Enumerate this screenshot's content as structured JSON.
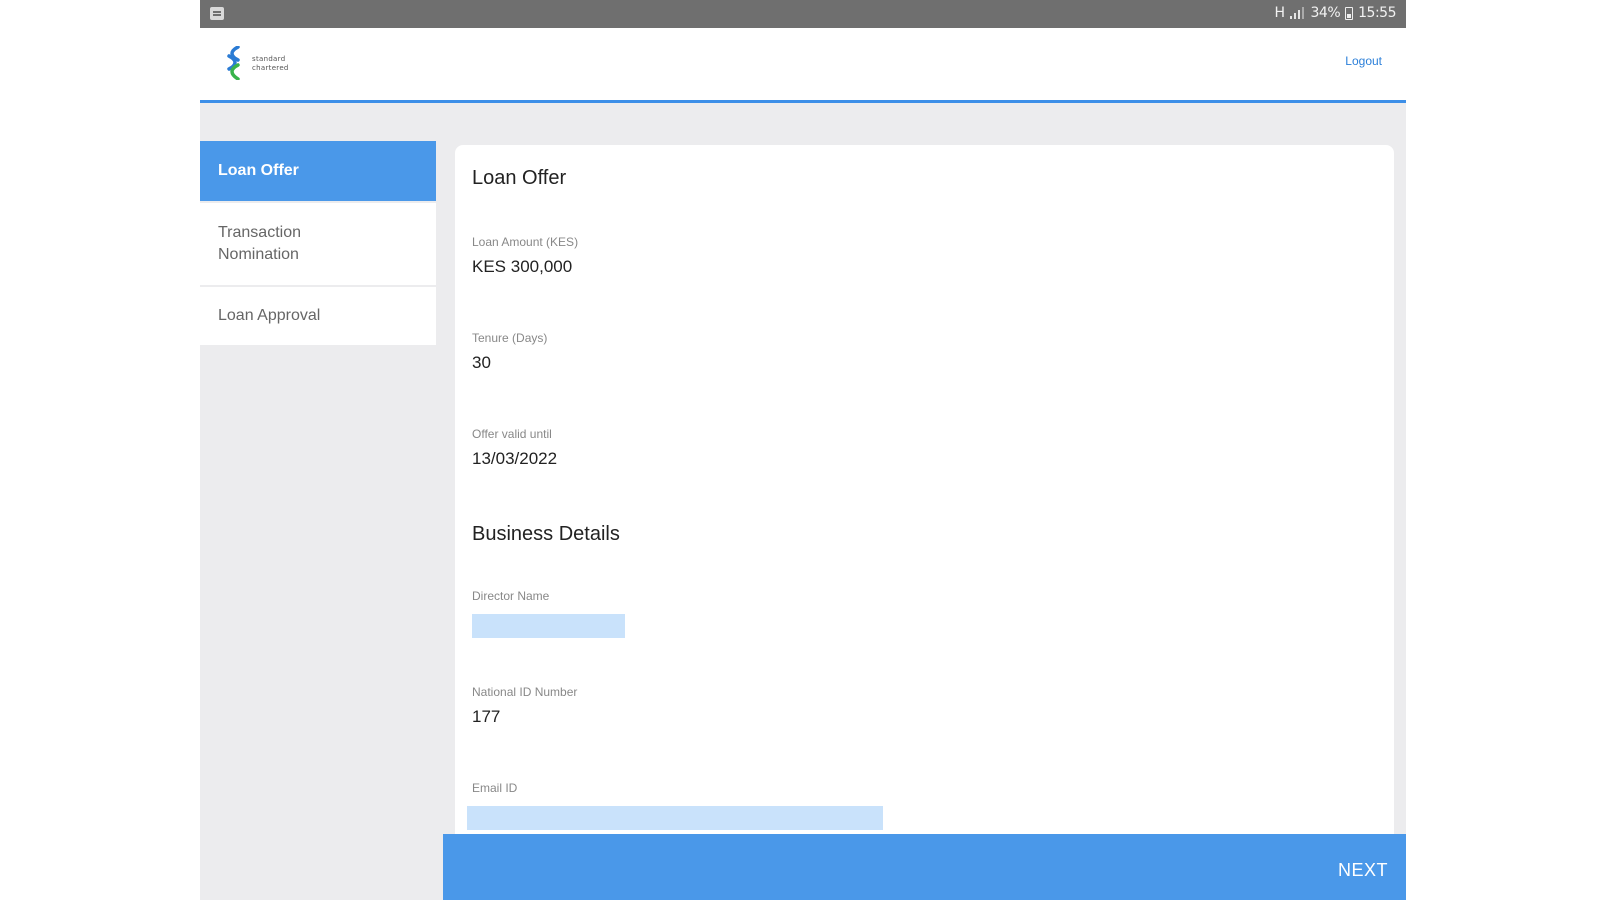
{
  "status_bar": {
    "network": "H",
    "battery": "34%",
    "time": "15:55"
  },
  "header": {
    "logo_alt": "Standard Chartered",
    "logo_line1": "standard",
    "logo_line2": "chartered",
    "logout_label": "Logout"
  },
  "sidebar": {
    "items": [
      {
        "label": "Loan Offer",
        "active": true
      },
      {
        "label_line1": "Transaction",
        "label_line2": "Nomination",
        "active": false
      },
      {
        "label": "Loan Approval",
        "active": false
      }
    ]
  },
  "main": {
    "loan_offer_title": "Loan Offer",
    "loan_amount_label": "Loan Amount (KES)",
    "loan_amount_value": "KES 300,000",
    "tenure_label": "Tenure (Days)",
    "tenure_value": "30",
    "offer_valid_label": "Offer valid until",
    "offer_valid_value": "13/03/2022",
    "business_title": "Business Details",
    "director_name_label": "Director Name",
    "director_name_value": "",
    "national_id_label": "National ID Number",
    "national_id_value": "177",
    "email_label": "Email ID",
    "email_value": ""
  },
  "footer": {
    "next_label": "NEXT"
  },
  "colors": {
    "accent": "#4a98e9",
    "header_border": "#3d8fe8",
    "field_fill": "#c9e2fb",
    "status_bar": "#6f6f6f",
    "page_bg": "#ececee"
  }
}
